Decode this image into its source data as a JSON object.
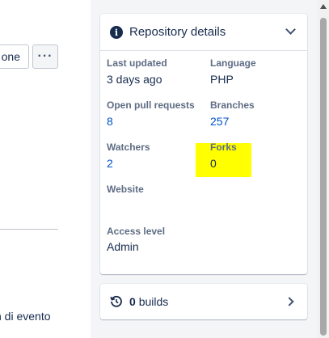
{
  "toolbar": {
    "clone_label": "one",
    "more_label": "···"
  },
  "left": {
    "event_text": "n di evento"
  },
  "details": {
    "title": "Repository details",
    "last_updated_label": "Last updated",
    "last_updated_value": "3 days ago",
    "language_label": "Language",
    "language_value": "PHP",
    "open_prs_label": "Open pull requests",
    "open_prs_value": "8",
    "branches_label": "Branches",
    "branches_value": "257",
    "watchers_label": "Watchers",
    "watchers_value": "2",
    "forks_label": "Forks",
    "forks_value": "0",
    "website_label": "Website",
    "access_label": "Access level",
    "access_value": "Admin"
  },
  "builds": {
    "count": "0",
    "label": "builds"
  },
  "icons": {
    "info": "info-icon",
    "chevron_down": "chevron-down-icon",
    "builds": "history-icon",
    "chevron_right": "chevron-right-icon"
  },
  "colors": {
    "link": "#0052cc",
    "highlight": "#ffff00",
    "panel_bg": "#f4f5f7"
  }
}
